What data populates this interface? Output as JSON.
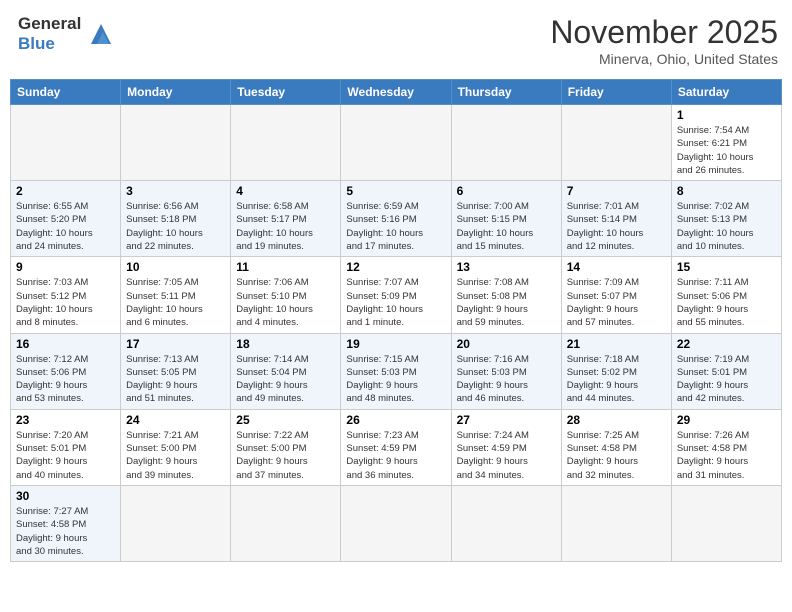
{
  "header": {
    "logo_text_general": "General",
    "logo_text_blue": "Blue",
    "month_title": "November 2025",
    "location": "Minerva, Ohio, United States"
  },
  "calendar": {
    "headers": [
      "Sunday",
      "Monday",
      "Tuesday",
      "Wednesday",
      "Thursday",
      "Friday",
      "Saturday"
    ],
    "weeks": [
      [
        {
          "day": "",
          "info": ""
        },
        {
          "day": "",
          "info": ""
        },
        {
          "day": "",
          "info": ""
        },
        {
          "day": "",
          "info": ""
        },
        {
          "day": "",
          "info": ""
        },
        {
          "day": "",
          "info": ""
        },
        {
          "day": "1",
          "info": "Sunrise: 7:54 AM\nSunset: 6:21 PM\nDaylight: 10 hours\nand 26 minutes."
        }
      ],
      [
        {
          "day": "2",
          "info": "Sunrise: 6:55 AM\nSunset: 5:20 PM\nDaylight: 10 hours\nand 24 minutes."
        },
        {
          "day": "3",
          "info": "Sunrise: 6:56 AM\nSunset: 5:18 PM\nDaylight: 10 hours\nand 22 minutes."
        },
        {
          "day": "4",
          "info": "Sunrise: 6:58 AM\nSunset: 5:17 PM\nDaylight: 10 hours\nand 19 minutes."
        },
        {
          "day": "5",
          "info": "Sunrise: 6:59 AM\nSunset: 5:16 PM\nDaylight: 10 hours\nand 17 minutes."
        },
        {
          "day": "6",
          "info": "Sunrise: 7:00 AM\nSunset: 5:15 PM\nDaylight: 10 hours\nand 15 minutes."
        },
        {
          "day": "7",
          "info": "Sunrise: 7:01 AM\nSunset: 5:14 PM\nDaylight: 10 hours\nand 12 minutes."
        },
        {
          "day": "8",
          "info": "Sunrise: 7:02 AM\nSunset: 5:13 PM\nDaylight: 10 hours\nand 10 minutes."
        }
      ],
      [
        {
          "day": "9",
          "info": "Sunrise: 7:03 AM\nSunset: 5:12 PM\nDaylight: 10 hours\nand 8 minutes."
        },
        {
          "day": "10",
          "info": "Sunrise: 7:05 AM\nSunset: 5:11 PM\nDaylight: 10 hours\nand 6 minutes."
        },
        {
          "day": "11",
          "info": "Sunrise: 7:06 AM\nSunset: 5:10 PM\nDaylight: 10 hours\nand 4 minutes."
        },
        {
          "day": "12",
          "info": "Sunrise: 7:07 AM\nSunset: 5:09 PM\nDaylight: 10 hours\nand 1 minute."
        },
        {
          "day": "13",
          "info": "Sunrise: 7:08 AM\nSunset: 5:08 PM\nDaylight: 9 hours\nand 59 minutes."
        },
        {
          "day": "14",
          "info": "Sunrise: 7:09 AM\nSunset: 5:07 PM\nDaylight: 9 hours\nand 57 minutes."
        },
        {
          "day": "15",
          "info": "Sunrise: 7:11 AM\nSunset: 5:06 PM\nDaylight: 9 hours\nand 55 minutes."
        }
      ],
      [
        {
          "day": "16",
          "info": "Sunrise: 7:12 AM\nSunset: 5:06 PM\nDaylight: 9 hours\nand 53 minutes."
        },
        {
          "day": "17",
          "info": "Sunrise: 7:13 AM\nSunset: 5:05 PM\nDaylight: 9 hours\nand 51 minutes."
        },
        {
          "day": "18",
          "info": "Sunrise: 7:14 AM\nSunset: 5:04 PM\nDaylight: 9 hours\nand 49 minutes."
        },
        {
          "day": "19",
          "info": "Sunrise: 7:15 AM\nSunset: 5:03 PM\nDaylight: 9 hours\nand 48 minutes."
        },
        {
          "day": "20",
          "info": "Sunrise: 7:16 AM\nSunset: 5:03 PM\nDaylight: 9 hours\nand 46 minutes."
        },
        {
          "day": "21",
          "info": "Sunrise: 7:18 AM\nSunset: 5:02 PM\nDaylight: 9 hours\nand 44 minutes."
        },
        {
          "day": "22",
          "info": "Sunrise: 7:19 AM\nSunset: 5:01 PM\nDaylight: 9 hours\nand 42 minutes."
        }
      ],
      [
        {
          "day": "23",
          "info": "Sunrise: 7:20 AM\nSunset: 5:01 PM\nDaylight: 9 hours\nand 40 minutes."
        },
        {
          "day": "24",
          "info": "Sunrise: 7:21 AM\nSunset: 5:00 PM\nDaylight: 9 hours\nand 39 minutes."
        },
        {
          "day": "25",
          "info": "Sunrise: 7:22 AM\nSunset: 5:00 PM\nDaylight: 9 hours\nand 37 minutes."
        },
        {
          "day": "26",
          "info": "Sunrise: 7:23 AM\nSunset: 4:59 PM\nDaylight: 9 hours\nand 36 minutes."
        },
        {
          "day": "27",
          "info": "Sunrise: 7:24 AM\nSunset: 4:59 PM\nDaylight: 9 hours\nand 34 minutes."
        },
        {
          "day": "28",
          "info": "Sunrise: 7:25 AM\nSunset: 4:58 PM\nDaylight: 9 hours\nand 32 minutes."
        },
        {
          "day": "29",
          "info": "Sunrise: 7:26 AM\nSunset: 4:58 PM\nDaylight: 9 hours\nand 31 minutes."
        }
      ],
      [
        {
          "day": "30",
          "info": "Sunrise: 7:27 AM\nSunset: 4:58 PM\nDaylight: 9 hours\nand 30 minutes."
        },
        {
          "day": "",
          "info": ""
        },
        {
          "day": "",
          "info": ""
        },
        {
          "day": "",
          "info": ""
        },
        {
          "day": "",
          "info": ""
        },
        {
          "day": "",
          "info": ""
        },
        {
          "day": "",
          "info": ""
        }
      ]
    ]
  }
}
